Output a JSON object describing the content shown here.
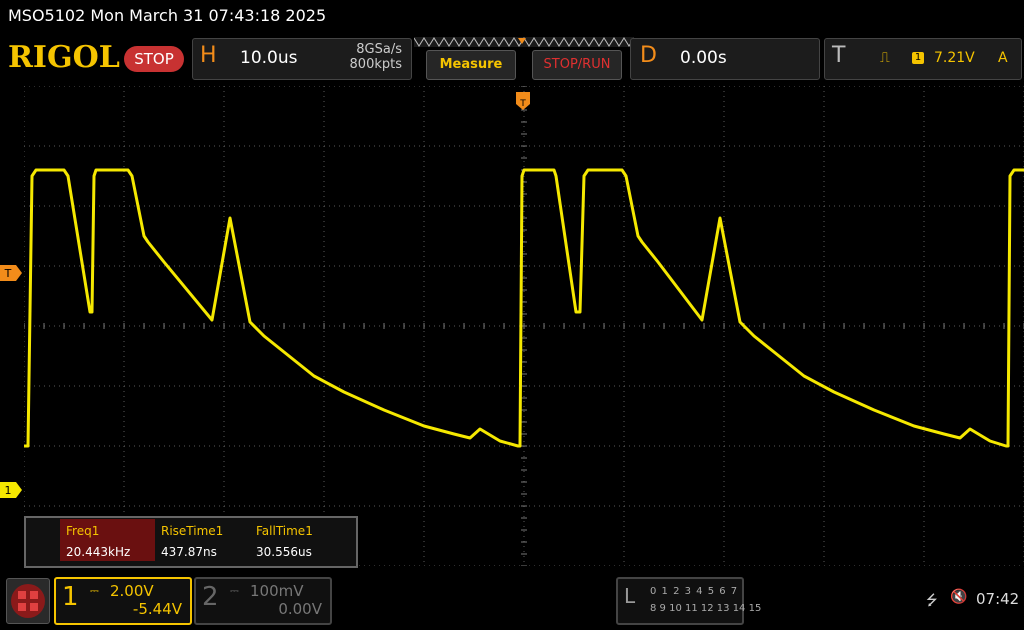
{
  "window": {
    "title": "MSO5102  Mon March 31 07:43:18 2025"
  },
  "header": {
    "logo": "RIGOL",
    "status": "STOP",
    "horizontal": {
      "letter": "H",
      "timebase": "10.0us",
      "sample_rate": "8GSa/s",
      "memory_depth": "800kpts"
    },
    "measure_label": "Measure",
    "stoprun_label": "STOP/RUN",
    "delay": {
      "letter": "D",
      "value": "0.00s"
    },
    "trigger": {
      "letter": "T",
      "edge_icon": "rising-edge-icon",
      "channel": "1",
      "level": "7.21V",
      "mode": "A"
    }
  },
  "markers": {
    "trigger_level": "T",
    "channel1": "1"
  },
  "measurements": {
    "items": [
      {
        "name": "Freq1",
        "value": "20.443kHz"
      },
      {
        "name": "RiseTime1",
        "value": "437.87ns"
      },
      {
        "name": "FallTime1",
        "value": "30.556us"
      }
    ]
  },
  "channels": {
    "ch1": {
      "number": "1",
      "scale": "2.00V",
      "offset": "-5.44V"
    },
    "ch2": {
      "number": "2",
      "scale": "100mV",
      "offset": "0.00V"
    }
  },
  "logic": {
    "letter": "L",
    "row1": "0 1 2 3  4 5 6 7",
    "row2": "8 9 10 11 12 13 14 15"
  },
  "status_bar": {
    "time": "07:42"
  },
  "colors": {
    "trace": "#f5e800",
    "accent": "#f28c1a",
    "grid": "#5a5a5a"
  }
}
